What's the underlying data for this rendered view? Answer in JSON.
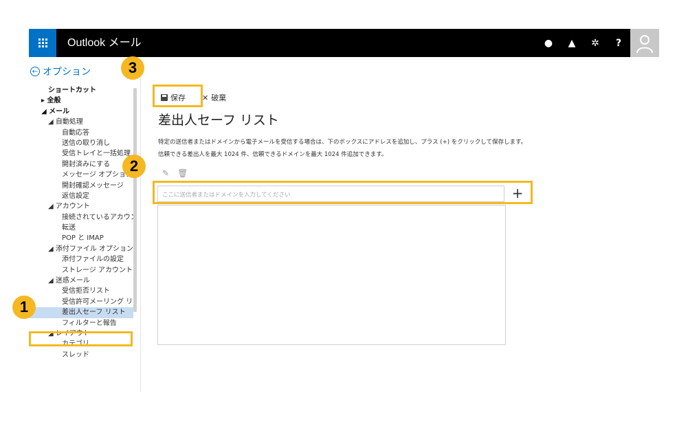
{
  "app": {
    "title": "Outlook メール"
  },
  "header": {
    "icons": [
      {
        "name": "chat-icon",
        "glyph": "●"
      },
      {
        "name": "bell-icon",
        "glyph": "▲"
      },
      {
        "name": "gear-icon",
        "glyph": "✲"
      },
      {
        "name": "help-icon",
        "glyph": "?"
      }
    ]
  },
  "back_link": {
    "label": "オプション",
    "icon": "back-arrow-icon"
  },
  "nav": {
    "items": [
      {
        "label": "ショートカット",
        "level": 1,
        "bold": true
      },
      {
        "label": "▸ 全般",
        "level": 0,
        "bold": true
      },
      {
        "label": "◢ メール",
        "level": 0,
        "bold": true
      },
      {
        "label": "◢ 自動処理",
        "level": 1
      },
      {
        "label": "自動応答",
        "level": 2
      },
      {
        "label": "送信の取り消し",
        "level": 2
      },
      {
        "label": "受信トレイと一括処理",
        "level": 2
      },
      {
        "label": "開封済みにする",
        "level": 2
      },
      {
        "label": "メッセージ オプション",
        "level": 2
      },
      {
        "label": "開封確認メッセージ",
        "level": 2
      },
      {
        "label": "返信設定",
        "level": 2
      },
      {
        "label": "◢ アカウント",
        "level": 1
      },
      {
        "label": "接続されているアカウント",
        "level": 2
      },
      {
        "label": "転送",
        "level": 2
      },
      {
        "label": "POP と IMAP",
        "level": 2
      },
      {
        "label": "◢ 添付ファイル オプション",
        "level": 1
      },
      {
        "label": "添付ファイルの設定",
        "level": 2
      },
      {
        "label": "ストレージ アカウント",
        "level": 2
      },
      {
        "label": "◢ 迷惑メール",
        "level": 1
      },
      {
        "label": "受信拒否リスト",
        "level": 2
      },
      {
        "label": "受信許可メーリング リスト",
        "level": 2
      },
      {
        "label": "差出人セーフ リスト",
        "level": 2,
        "selected": true
      },
      {
        "label": "フィルターと報告",
        "level": 2
      },
      {
        "label": "◢ レイアウト",
        "level": 1
      },
      {
        "label": "カテゴリ",
        "level": 2
      },
      {
        "label": "スレッド",
        "level": 2
      }
    ]
  },
  "toolbar": {
    "save_label": "保存",
    "discard_label": "破棄",
    "discard_icon": "✕"
  },
  "main": {
    "title": "差出人セーフ リスト",
    "description_line1": "特定の送信者またはドメインから電子メールを受信する場合は、下のボックスにアドレスを追加し、プラス (+) をクリックして保存します。",
    "description_line2": "信頼できる差出人を最大 1024 件、信頼できるドメインを最大 1024 件追加できます。",
    "edit_icon": "✎",
    "delete_icon": "🗑",
    "input_placeholder": "ここに送信者またはドメインを入力してください",
    "input_value": "",
    "add_button": "+"
  },
  "annotations": {
    "step1": "1",
    "step2": "2",
    "step3": "3",
    "color": "#f5b821"
  },
  "colors": {
    "accent": "#0072c6",
    "selected_bg": "#c7dcf2",
    "topbar": "#000000"
  }
}
